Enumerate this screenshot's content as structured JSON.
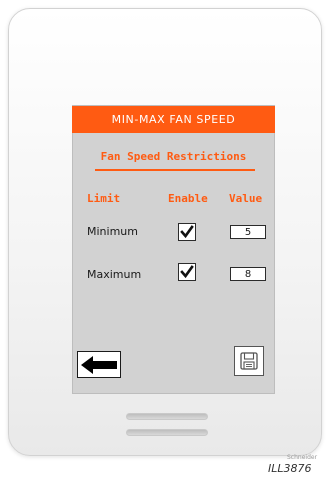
{
  "screen": {
    "title": "MIN-MAX FAN SPEED",
    "subtitle": "Fan Speed Restrictions",
    "columns": {
      "limit": "Limit",
      "enable": "Enable",
      "value": "Value"
    },
    "rows": [
      {
        "label": "Minimum",
        "enabled": true,
        "value": "5"
      },
      {
        "label": "Maximum",
        "enabled": true,
        "value": "8"
      }
    ],
    "back_icon": "left-arrow-icon",
    "save_icon": "floppy-disk-icon"
  },
  "device": {
    "brand": "Schneider",
    "illustration_ref": "ILL3876"
  },
  "colors": {
    "accent": "#ff5b12",
    "screen_bg": "#d2d2d2",
    "frame": "#f3f3f3"
  }
}
